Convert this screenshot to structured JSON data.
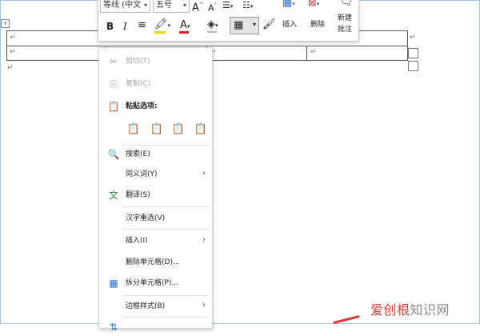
{
  "mini_toolbar": {
    "font_name": "等线 (中文",
    "font_size": "五号",
    "grow_font": "A",
    "shrink_font": "A",
    "bold": "B",
    "italic": "I",
    "insert_label": "插入",
    "delete_label": "删除",
    "new_comment_label_line1": "新建",
    "new_comment_label_line2": "批注"
  },
  "doc": {
    "para_mark": "↵"
  },
  "context_menu": {
    "cut": "剪切(T)",
    "copy": "复制(C)",
    "paste_options": "粘贴选项:",
    "search": "搜索(E)",
    "synonyms": "同义词(Y)",
    "translate": "翻译(S)",
    "reconvert": "汉字重选(V)",
    "insert": "插入(I)",
    "delete_cells": "删除单元格(D)...",
    "split_cells": "拆分单元格(P)...",
    "border_styles": "边框样式(B)",
    "submenu_arrow": "›"
  },
  "watermark": {
    "prefix": "爱创根",
    "suffix": "知识网"
  },
  "colors": {
    "frame": "#9fc4e0",
    "highlight_yellow": "#f5d90a",
    "font_color_red": "#e02020",
    "accent_blue": "#2a6fc9",
    "watermark_red": "#cf3b2f"
  }
}
